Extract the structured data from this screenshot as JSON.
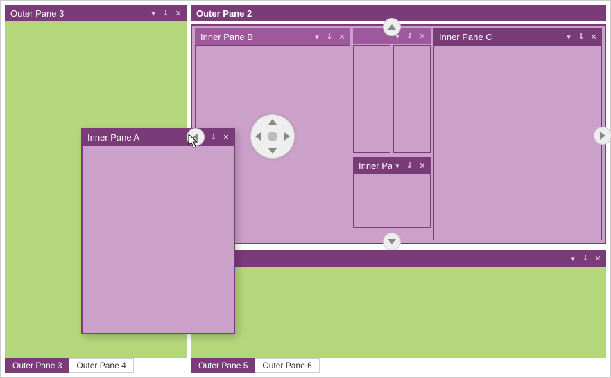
{
  "colors": {
    "accent_dark": "#7a3b79",
    "accent_light": "#9e599c",
    "pane_fill": "#cba1c9",
    "green": "#b4d77b"
  },
  "app": {
    "close_icon": "close"
  },
  "outer_left": {
    "title": "Outer Pane 3",
    "tabs": [
      {
        "label": "Outer Pane 3",
        "active": true
      },
      {
        "label": "Outer Pane 4",
        "active": false
      }
    ]
  },
  "outer_right": {
    "title": "Outer Pane 2",
    "inner_strip_title": "",
    "tabs": [
      {
        "label": "Outer Pane 5",
        "active": true
      },
      {
        "label": "Outer Pane 6",
        "active": false
      }
    ]
  },
  "inner_b": {
    "title": "Inner Pane B"
  },
  "inner_small_top": {
    "title": ""
  },
  "inner_pa": {
    "title": "Inner Pa"
  },
  "inner_c": {
    "title": "Inner Pane C"
  },
  "floating_a": {
    "title": "Inner Pane A"
  },
  "dock_hints": {
    "left": "dock-left",
    "right": "dock-right",
    "top": "dock-top",
    "bottom": "dock-bottom",
    "center": "dock-center"
  }
}
